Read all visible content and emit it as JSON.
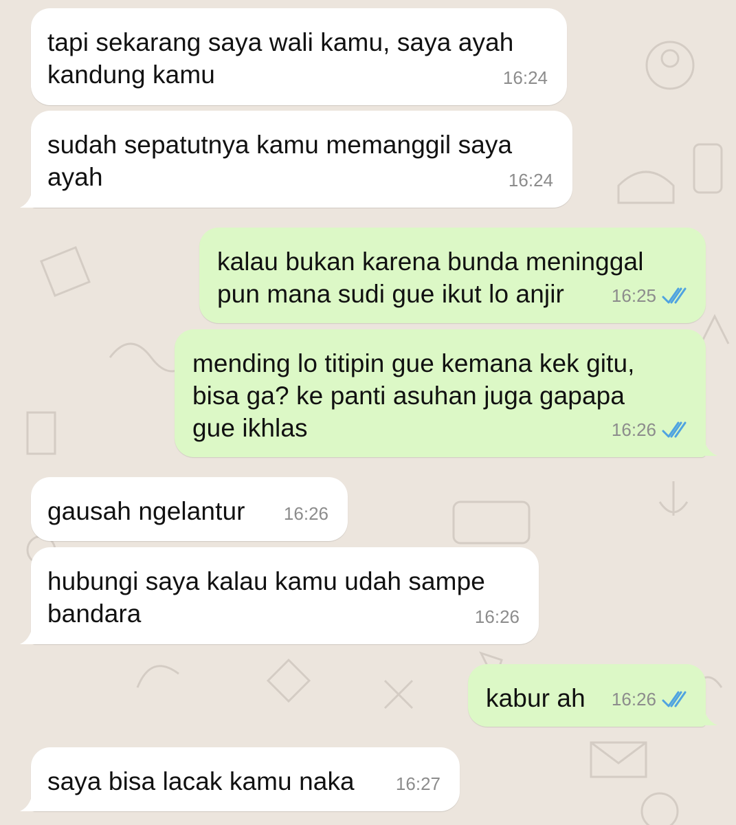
{
  "accent": {
    "tick": "#4fa3e0",
    "incoming": "#ffffff",
    "outgoing": "#dcf8c6",
    "wallpaper": "#ece5dd"
  },
  "messages": [
    {
      "direction": "incoming",
      "text": "tapi sekarang saya wali kamu, saya ayah\nkandung kamu",
      "time": "16:24"
    },
    {
      "direction": "incoming",
      "text": "sudah sepatutnya kamu memanggil saya\nayah",
      "time": "16:24"
    },
    {
      "direction": "outgoing",
      "text": "kalau bukan karena bunda meninggal\npun mana sudi gue ikut lo anjir",
      "time": "16:25",
      "status_icon": "double-check-read-icon"
    },
    {
      "direction": "outgoing",
      "text": "mending lo titipin gue kemana kek gitu,\nbisa ga? ke panti asuhan juga gapapa\ngue ikhlas",
      "time": "16:26",
      "status_icon": "double-check-read-icon"
    },
    {
      "direction": "incoming",
      "text": "gausah ngelantur",
      "time": "16:26"
    },
    {
      "direction": "incoming",
      "text": "hubungi saya kalau kamu udah sampe\nbandara",
      "time": "16:26"
    },
    {
      "direction": "outgoing",
      "text": "kabur ah",
      "time": "16:26",
      "status_icon": "double-check-read-icon"
    },
    {
      "direction": "incoming",
      "text": "saya bisa lacak kamu naka",
      "time": "16:27"
    }
  ]
}
